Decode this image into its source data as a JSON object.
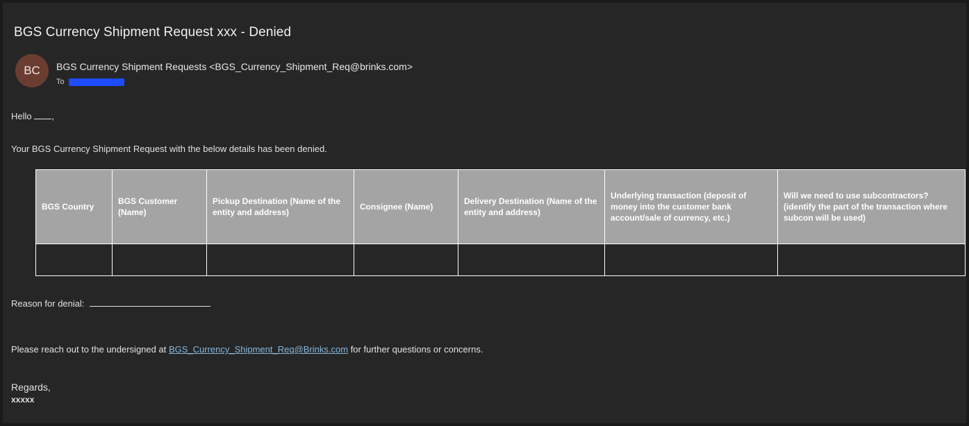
{
  "email": {
    "subject": "BGS Currency Shipment Request xxx - Denied",
    "avatar_initials": "BC",
    "sender": "BGS Currency Shipment Requests <BGS_Currency_Shipment_Req@brinks.com>",
    "to_label": "To",
    "greeting": "Hello",
    "greeting_suffix": ",",
    "intro": "Your BGS Currency Shipment Request with the below details has been denied.",
    "reason_label": "Reason for denial:",
    "contact_prefix": "Please reach out to the undersigned at ",
    "contact_link": "BGS_Currency_Shipment_Req@Brinks.com",
    "contact_suffix": " for further questions or concerns.",
    "regards": "Regards,",
    "signature": "xxxxx"
  },
  "table": {
    "headers": [
      "BGS Country",
      "BGS Customer (Name)",
      "Pickup Destination (Name of the entity and address)",
      "Consignee (Name)",
      "Delivery Destination (Name of the entity and address)",
      "Underlying transaction (deposit of money into the customer bank account/sale of currency, etc.)",
      "Will we need to use subcontractors? (identify the part of the transaction where subcon will be used)"
    ],
    "row": [
      "",
      "",
      "",
      "",
      "",
      "",
      ""
    ]
  },
  "colors": {
    "background": "#262626",
    "header_fill": "#a4a4a4",
    "avatar": "#6b3d31",
    "link": "#86b7dd",
    "redaction": "#1d4bff"
  }
}
